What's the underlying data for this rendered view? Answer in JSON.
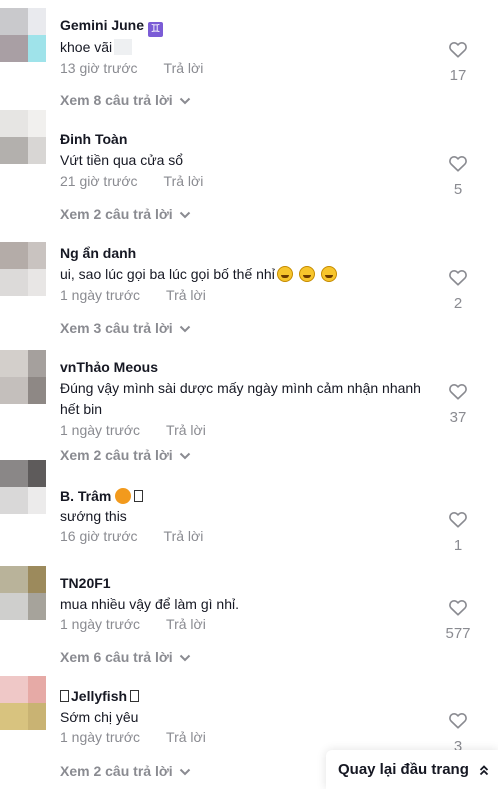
{
  "comments": [
    {
      "name": "Gemini June",
      "name_badge": "♊",
      "text": "khoe vãi",
      "time": "13 giờ trước",
      "reply_label": "Trả lời",
      "likes": "17",
      "view_replies": "Xem 8 câu trả lời",
      "avatar_colors": [
        "#c9c9cc",
        "#e9eaee",
        "#a99fa4",
        "#9fe3ea"
      ]
    },
    {
      "name": "Đinh Toàn",
      "text": "Vứt tiền qua cửa sổ",
      "time": "21 giờ trước",
      "reply_label": "Trả lời",
      "likes": "5",
      "view_replies": "Xem 2 câu trả lời",
      "avatar_colors": [
        "#e6e5e3",
        "#f1f0ee",
        "#b3b0ad",
        "#d8d6d4"
      ]
    },
    {
      "name": "Ng ẩn danh",
      "text": "ui, sao lúc gọi ba lúc gọi bố thế nhỉ",
      "time": "1 ngày trước",
      "reply_label": "Trả lời",
      "likes": "2",
      "view_replies": "Xem 3 câu trả lời",
      "avatar_colors": [
        "#b4aca8",
        "#c9c3c0",
        "#dcdad9",
        "#e8e6e5"
      ]
    },
    {
      "name": "vnThảo Meous",
      "text": "Đúng vậy mình sài dược mấy ngày mình cảm nhận nhanh hết bin",
      "time": "1 ngày trước",
      "reply_label": "Trả lời",
      "likes": "37",
      "view_replies": "Xem 2 câu trả lời",
      "avatar_colors": [
        "#d3cfcb",
        "#a5a09d",
        "#c4bfbc",
        "#8e8885"
      ]
    },
    {
      "name": "B. Trâm",
      "text": "sướng this",
      "time": "16 giờ trước",
      "reply_label": "Trả lời",
      "likes": "1",
      "view_replies": "",
      "avatar_colors": [
        "#8a8787",
        "#5e5b5b",
        "#d9d8d8",
        "#ecebeb"
      ]
    },
    {
      "name": "TN20F1",
      "text": "mua nhiều vậy để làm gì nhỉ.",
      "time": "1 ngày trước",
      "reply_label": "Trả lời",
      "likes": "577",
      "view_replies": "Xem 6 câu trả lời",
      "avatar_colors": [
        "#b9b39a",
        "#9c8a5c",
        "#cfcfcd",
        "#a6a39b"
      ]
    },
    {
      "name": "Jellyfish",
      "text": "Sớm chị yêu",
      "time": "1 ngày trước",
      "reply_label": "Trả lời",
      "likes": "3",
      "view_replies": "Xem 2 câu trả lời",
      "avatar_colors": [
        "#efc8c7",
        "#e6aaa6",
        "#d8c37f",
        "#c9b373"
      ]
    }
  ],
  "back_to_top": "Quay lại đầu trang",
  "icons": {
    "like": "heart-outline-icon",
    "expand": "chevron-down-icon",
    "back_top": "chevron-double-up-icon"
  },
  "colors": {
    "text": "#161823",
    "muted": "#8a8b91"
  }
}
